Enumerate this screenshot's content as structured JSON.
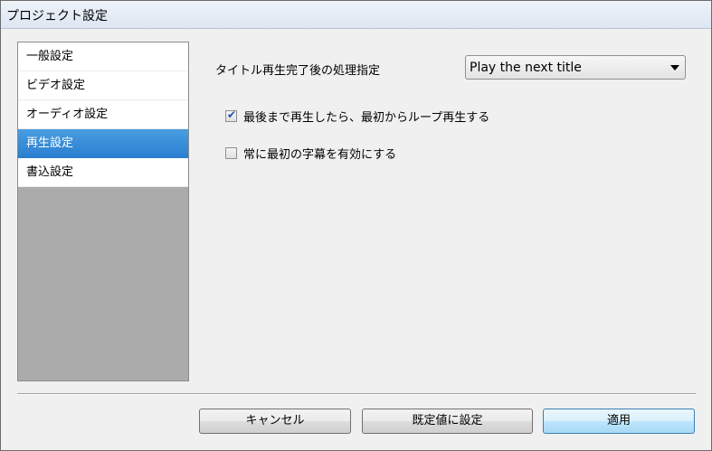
{
  "window": {
    "title": "プロジェクト設定"
  },
  "sidebar": {
    "items": [
      {
        "label": "一般設定"
      },
      {
        "label": "ビデオ設定"
      },
      {
        "label": "オーディオ設定"
      },
      {
        "label": "再生設定",
        "selected": true
      },
      {
        "label": "書込設定"
      }
    ]
  },
  "playback": {
    "after_title_label": "タイトル再生完了後の処理指定",
    "after_title_value": "Play the next title",
    "loop": {
      "label": "最後まで再生したら、最初からループ再生する",
      "checked": true
    },
    "subtitle": {
      "label": "常に最初の字幕を有効にする",
      "checked": false
    }
  },
  "buttons": {
    "cancel": "キャンセル",
    "reset_default": "既定値に設定",
    "apply": "適用"
  },
  "colors": {
    "selection": "#2a7fd0",
    "sidebar_empty": "#ababab"
  }
}
